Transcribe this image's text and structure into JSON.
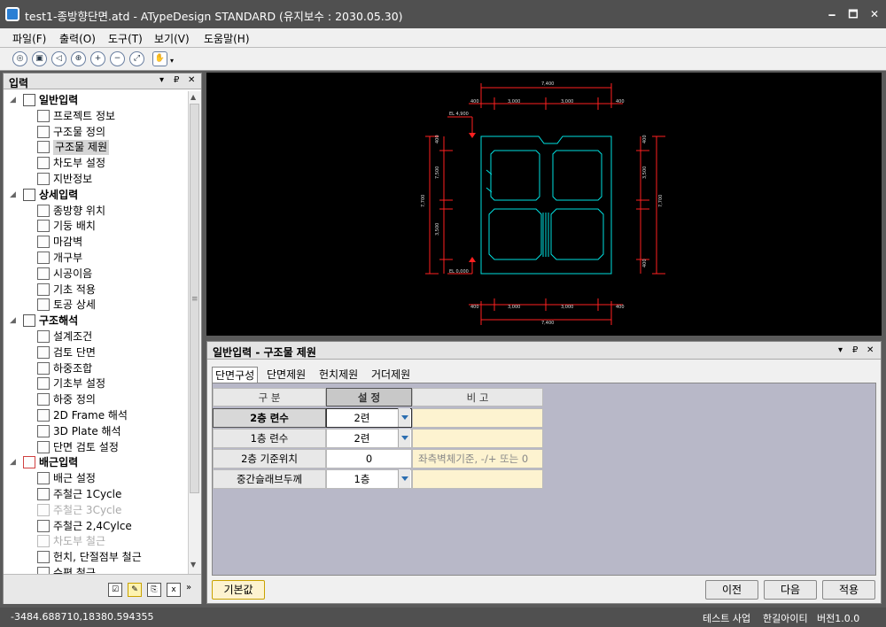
{
  "window": {
    "title": "test1-종방향단면.atd - ATypeDesign STANDARD  (유지보수 : 2030.05.30)",
    "minimize": "🗕",
    "maximize": "🗖",
    "close": "✕"
  },
  "menu": [
    "파일(F)",
    "출력(O)",
    "도구(T)",
    "보기(V)",
    "도움말(H)"
  ],
  "toolbar": {
    "icons": [
      "zoom-fit-icon",
      "zoom-window-icon",
      "zoom-previous-icon",
      "zoom-all-icon",
      "zoom-in-icon",
      "zoom-out-icon",
      "zoom-extent-icon",
      "pan-hand-icon"
    ]
  },
  "left_panel": {
    "title": "입력",
    "pin": "▾ ₽ ✕",
    "tree": [
      {
        "label": "일반입력",
        "level": 0,
        "category": true,
        "icon": "document-icon"
      },
      {
        "label": "프로젝트 정보",
        "level": 1,
        "icon": "project-info-icon"
      },
      {
        "label": "구조물 정의",
        "level": 1,
        "icon": "structure-define-icon"
      },
      {
        "label": "구조물 제원",
        "level": 1,
        "icon": "structure-spec-icon",
        "selected": true
      },
      {
        "label": "차도부 설정",
        "level": 1,
        "icon": "roadway-icon"
      },
      {
        "label": "지반정보",
        "level": 1,
        "icon": "ground-info-icon"
      },
      {
        "label": "상세입력",
        "level": 0,
        "category": true,
        "icon": "detail-input-icon"
      },
      {
        "label": "종방향 위치",
        "level": 1,
        "icon": "longitudinal-position-icon"
      },
      {
        "label": "기둥 배치",
        "level": 1,
        "icon": "column-layout-icon"
      },
      {
        "label": "마감벽",
        "level": 1,
        "icon": "finish-wall-icon"
      },
      {
        "label": "개구부",
        "level": 1,
        "icon": "opening-icon"
      },
      {
        "label": "시공이음",
        "level": 1,
        "icon": "construction-joint-icon"
      },
      {
        "label": "기초 적용",
        "level": 1,
        "icon": "foundation-apply-icon"
      },
      {
        "label": "토공 상세",
        "level": 1,
        "icon": "earthwork-icon"
      },
      {
        "label": "구조해석",
        "level": 0,
        "category": true,
        "icon": "analysis-icon"
      },
      {
        "label": "설계조건",
        "level": 1,
        "icon": "design-condition-icon"
      },
      {
        "label": "검토 단면",
        "level": 1,
        "icon": "check-section-icon"
      },
      {
        "label": "하중조합",
        "level": 1,
        "icon": "load-combination-icon"
      },
      {
        "label": "기초부 설정",
        "level": 1,
        "icon": "foundation-setting-icon"
      },
      {
        "label": "하중 정의",
        "level": 1,
        "icon": "load-define-icon"
      },
      {
        "label": "2D Frame 해석",
        "level": 1,
        "icon": "frame-2d-icon"
      },
      {
        "label": "3D Plate 해석",
        "level": 1,
        "icon": "plate-3d-icon"
      },
      {
        "label": "단면 검토 설정",
        "level": 1,
        "icon": "section-check-icon"
      },
      {
        "label": "배근입력",
        "level": 0,
        "category": true,
        "icon": "rebar-input-icon"
      },
      {
        "label": "배근 설정",
        "level": 1,
        "icon": "rebar-setting-icon"
      },
      {
        "label": "주철근 1Cycle",
        "level": 1,
        "icon": "main-rebar-icon"
      },
      {
        "label": "주철근 3Cycle",
        "level": 1,
        "icon": "main-rebar-icon",
        "disabled": true
      },
      {
        "label": "주철근 2,4Cylce",
        "level": 1,
        "icon": "main-rebar-icon"
      },
      {
        "label": "차도부 철근",
        "level": 1,
        "icon": "roadway-rebar-icon",
        "disabled": true
      },
      {
        "label": "헌치, 단절점부 철근",
        "level": 1,
        "icon": "haunch-rebar-icon"
      },
      {
        "label": "수평 철근",
        "level": 1,
        "icon": "horizontal-rebar-icon"
      }
    ]
  },
  "drawing": {
    "labels": [
      "7,400",
      "400",
      "3,000",
      "3,000",
      "400",
      "7,400",
      "400",
      "3,000",
      "3,000",
      "400",
      "7,700",
      "7,700",
      "7,500",
      "3,500",
      "3,500",
      "400",
      "400",
      "400",
      "EL 4,900",
      "EL 0,000"
    ]
  },
  "bottom_panel": {
    "title": "일반입력 - 구조물 제원",
    "tabs": [
      "단면구성",
      "단면제원",
      "헌치제원",
      "거더제원"
    ],
    "grid": {
      "headers": [
        "구 분",
        "설 정",
        "비 고"
      ],
      "rows": [
        {
          "label": "2층 련수",
          "value": "2련",
          "note": "",
          "dropdown": true,
          "bold": true
        },
        {
          "label": "1층 련수",
          "value": "2련",
          "note": "",
          "dropdown": true
        },
        {
          "label": "2층 기준위치",
          "value": "0",
          "note": "좌측벽체기준, -/+ 또는 0",
          "dropdown": false
        },
        {
          "label": "중간슬래브두께",
          "value": "1층",
          "note": "",
          "dropdown": true
        }
      ]
    },
    "buttons": {
      "default": "기본값",
      "prev": "이전",
      "next": "다음",
      "apply": "적용"
    }
  },
  "status": {
    "x": "-3484.688710,",
    "y": "18380.594355",
    "mode": "테스트 사업",
    "company": "한길아이티",
    "version": "버전1.0.0"
  },
  "colors": {
    "chrome": "#505050",
    "canvas": "#000000",
    "section_lines": "#00e0e0",
    "dimension_lines": "#ff2020",
    "note_bg": "#fdf3d0"
  }
}
